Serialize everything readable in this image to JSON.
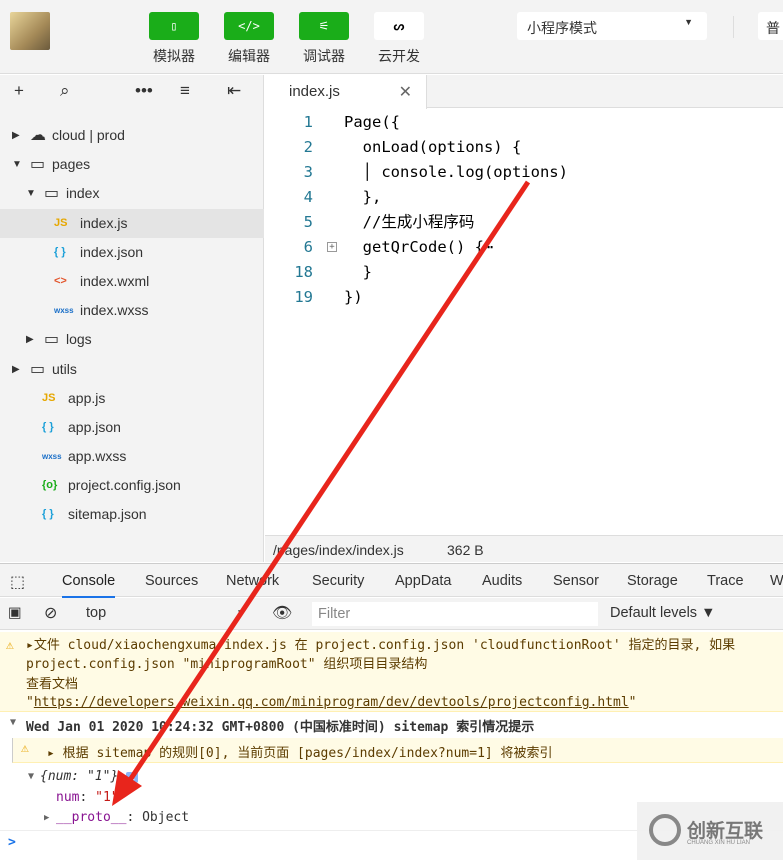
{
  "toolbar": {
    "buttons": [
      {
        "label": "模拟器",
        "icon": "phone-icon",
        "glyph": "▯"
      },
      {
        "label": "编辑器",
        "icon": "code-icon",
        "glyph": "</>"
      },
      {
        "label": "调试器",
        "icon": "debug-icon",
        "glyph": "⚟"
      },
      {
        "label": "云开发",
        "icon": "cloud-link-icon",
        "glyph": "ᔕ"
      }
    ],
    "mode": "小程序模式",
    "compile_mode": "普"
  },
  "sidebar": {
    "tools": [
      "+",
      "⌕",
      "•••",
      "≡",
      "⇤"
    ],
    "tree": [
      {
        "name": "cloud | prod",
        "type": "folder-cloud",
        "level": 0,
        "caret": "▶"
      },
      {
        "name": "pages",
        "type": "folder",
        "level": 0,
        "caret": "▼"
      },
      {
        "name": "index",
        "type": "folder",
        "level": 1,
        "caret": "▼"
      },
      {
        "name": "index.js",
        "type": "js",
        "level": 2,
        "selected": true
      },
      {
        "name": "index.json",
        "type": "json",
        "level": 2
      },
      {
        "name": "index.wxml",
        "type": "wxml",
        "level": 2
      },
      {
        "name": "index.wxss",
        "type": "wxss",
        "level": 2
      },
      {
        "name": "logs",
        "type": "folder",
        "level": 1,
        "caret": "▶"
      },
      {
        "name": "utils",
        "type": "folder",
        "level": 0,
        "caret": "▶"
      },
      {
        "name": "app.js",
        "type": "js",
        "level": 1
      },
      {
        "name": "app.json",
        "type": "json",
        "level": 1
      },
      {
        "name": "app.wxss",
        "type": "wxss",
        "level": 1
      },
      {
        "name": "project.config.json",
        "type": "config",
        "level": 1
      },
      {
        "name": "sitemap.json",
        "type": "json",
        "level": 1
      }
    ]
  },
  "editor": {
    "tab": "index.js",
    "lines": [
      {
        "n": "1",
        "text": "Page({"
      },
      {
        "n": "2",
        "text": "  onLoad(options) {"
      },
      {
        "n": "3",
        "text": "  │ console.log(options)"
      },
      {
        "n": "4",
        "text": "  },"
      },
      {
        "n": "5",
        "text": "  //生成小程序码",
        "comment": true
      },
      {
        "n": "6",
        "text": "  getQrCode() {⋯",
        "fold": true
      },
      {
        "n": "18",
        "text": "  }"
      },
      {
        "n": "19",
        "text": "})"
      }
    ],
    "status_path": "/pages/index/index.js",
    "status_size": "362 B"
  },
  "devtools": {
    "tabs": [
      "Console",
      "Sources",
      "Network",
      "Security",
      "AppData",
      "Audits",
      "Sensor",
      "Storage",
      "Trace",
      "W"
    ],
    "context": "top",
    "filter_placeholder": "Filter",
    "levels": "Default levels ▼"
  },
  "console": {
    "warn1_l1": "▸文件 cloud/xiaochengxuma/index.js 在 project.config.json 'cloudfunctionRoot' 指定的目录, 如果",
    "warn1_l2": "project.config.json \"miniprogramRoot\" 组织项目目录结构",
    "warn1_l3": "查看文档",
    "warn1_link": "https://developers.weixin.qq.com/miniprogram/dev/devtools/projectconfig.html",
    "group": "Wed Jan 01 2020 10:24:32 GMT+0800 (中国标准时间) sitemap 索引情况提示",
    "warn2": "▸ 根据 sitemap 的规则[0], 当前页面 [pages/index/index?num=1] 将被索引",
    "obj": "{num: \"1\"}",
    "prop_key": "num",
    "prop_val": "\"1\"",
    "proto": "__proto__",
    "proto_val": ": Object",
    "prompt": ">"
  },
  "watermark": {
    "text": "创新互联",
    "sub": "CHUANG XIN HU LIAN"
  }
}
